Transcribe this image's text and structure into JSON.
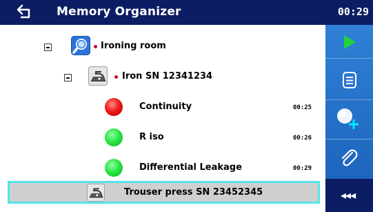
{
  "header": {
    "title": "Memory Organizer",
    "clock": "00:29",
    "back_icon": "back-arrow-icon"
  },
  "tree": {
    "location": {
      "label": "Ironing room",
      "icon": "location-search-icon",
      "expanded": true
    },
    "appliance": {
      "label": "Iron SN 12341234",
      "icon": "iron-appliance-icon",
      "expanded": true
    },
    "measurements": [
      {
        "label": "Continuity",
        "time": "00:25",
        "status": "fail"
      },
      {
        "label": "R iso",
        "time": "00:26",
        "status": "pass"
      },
      {
        "label": "Differential Leakage",
        "time": "00:29",
        "status": "pass"
      }
    ],
    "selected": {
      "label": "Trouser press SN 23452345",
      "icon": "iron-appliance-icon"
    }
  },
  "sidebar": {
    "buttons": [
      {
        "name": "run-button",
        "icon": "play-icon"
      },
      {
        "name": "view-results-button",
        "icon": "list-icon"
      },
      {
        "name": "add-measurement-button",
        "icon": "add-circle-icon"
      },
      {
        "name": "attach-button",
        "icon": "paperclip-icon"
      }
    ],
    "more_label": "◂◂◂"
  },
  "colors": {
    "header_bg": "#0b1d63",
    "sidebar_bg": "#2a77cf",
    "selection_border": "#55e3ea",
    "selection_bg": "#cfcfcf",
    "fail": "#f01a1a",
    "pass": "#26e23f",
    "play": "#22d13a"
  }
}
